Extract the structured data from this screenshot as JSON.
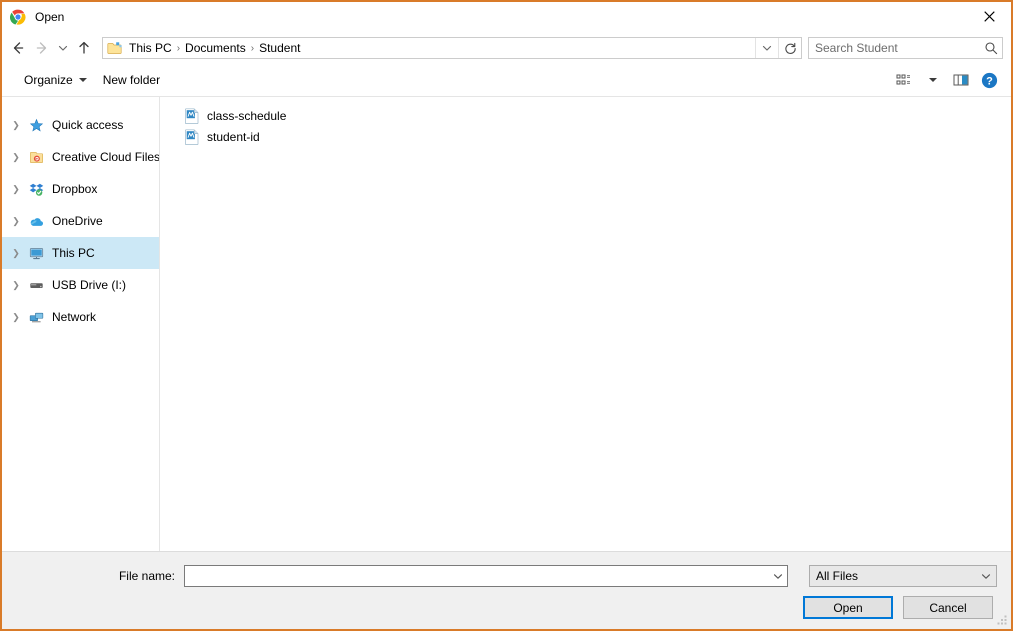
{
  "window": {
    "title": "Open",
    "app_icon": "chrome-icon",
    "close_label": "✕",
    "border_color": "#d97b29"
  },
  "navigation": {
    "back_tooltip": "Back",
    "forward_tooltip": "Forward",
    "recent_tooltip": "Recent locations",
    "up_tooltip": "Up",
    "breadcrumbs": [
      {
        "label": "This PC"
      },
      {
        "label": "Documents"
      },
      {
        "label": "Student"
      }
    ],
    "separator": "›",
    "refresh_tooltip": "Refresh"
  },
  "search": {
    "placeholder": "Search Student",
    "value": "",
    "icon": "search-icon"
  },
  "toolbar": {
    "organize_label": "Organize",
    "new_folder_label": "New folder",
    "view_icon": "view-layout-icon",
    "preview_icon": "preview-pane-icon",
    "help_icon": "help-icon"
  },
  "sidebar": {
    "items": [
      {
        "label": "Quick access",
        "icon": "star-icon",
        "selected": false
      },
      {
        "label": "Creative Cloud Files",
        "icon": "creative-cloud-icon",
        "selected": false
      },
      {
        "label": "Dropbox",
        "icon": "dropbox-icon",
        "selected": false
      },
      {
        "label": "OneDrive",
        "icon": "onedrive-cloud-icon",
        "selected": false
      },
      {
        "label": "This PC",
        "icon": "monitor-icon",
        "selected": true
      },
      {
        "label": "USB Drive (I:)",
        "icon": "usb-drive-icon",
        "selected": false
      },
      {
        "label": "Network",
        "icon": "network-icon",
        "selected": false
      }
    ]
  },
  "files": {
    "items": [
      {
        "name": "class-schedule",
        "icon": "word-document-icon"
      },
      {
        "name": "student-id",
        "icon": "word-document-icon"
      }
    ]
  },
  "footer": {
    "file_name_label": "File name:",
    "file_name_value": "",
    "file_name_placeholder": "",
    "file_type_selected": "All Files",
    "open_label": "Open",
    "cancel_label": "Cancel"
  },
  "colors": {
    "accent": "#0078d7",
    "selection": "#cce8f6",
    "window_border": "#d97b29",
    "footer_bg": "#f0f0f0"
  }
}
